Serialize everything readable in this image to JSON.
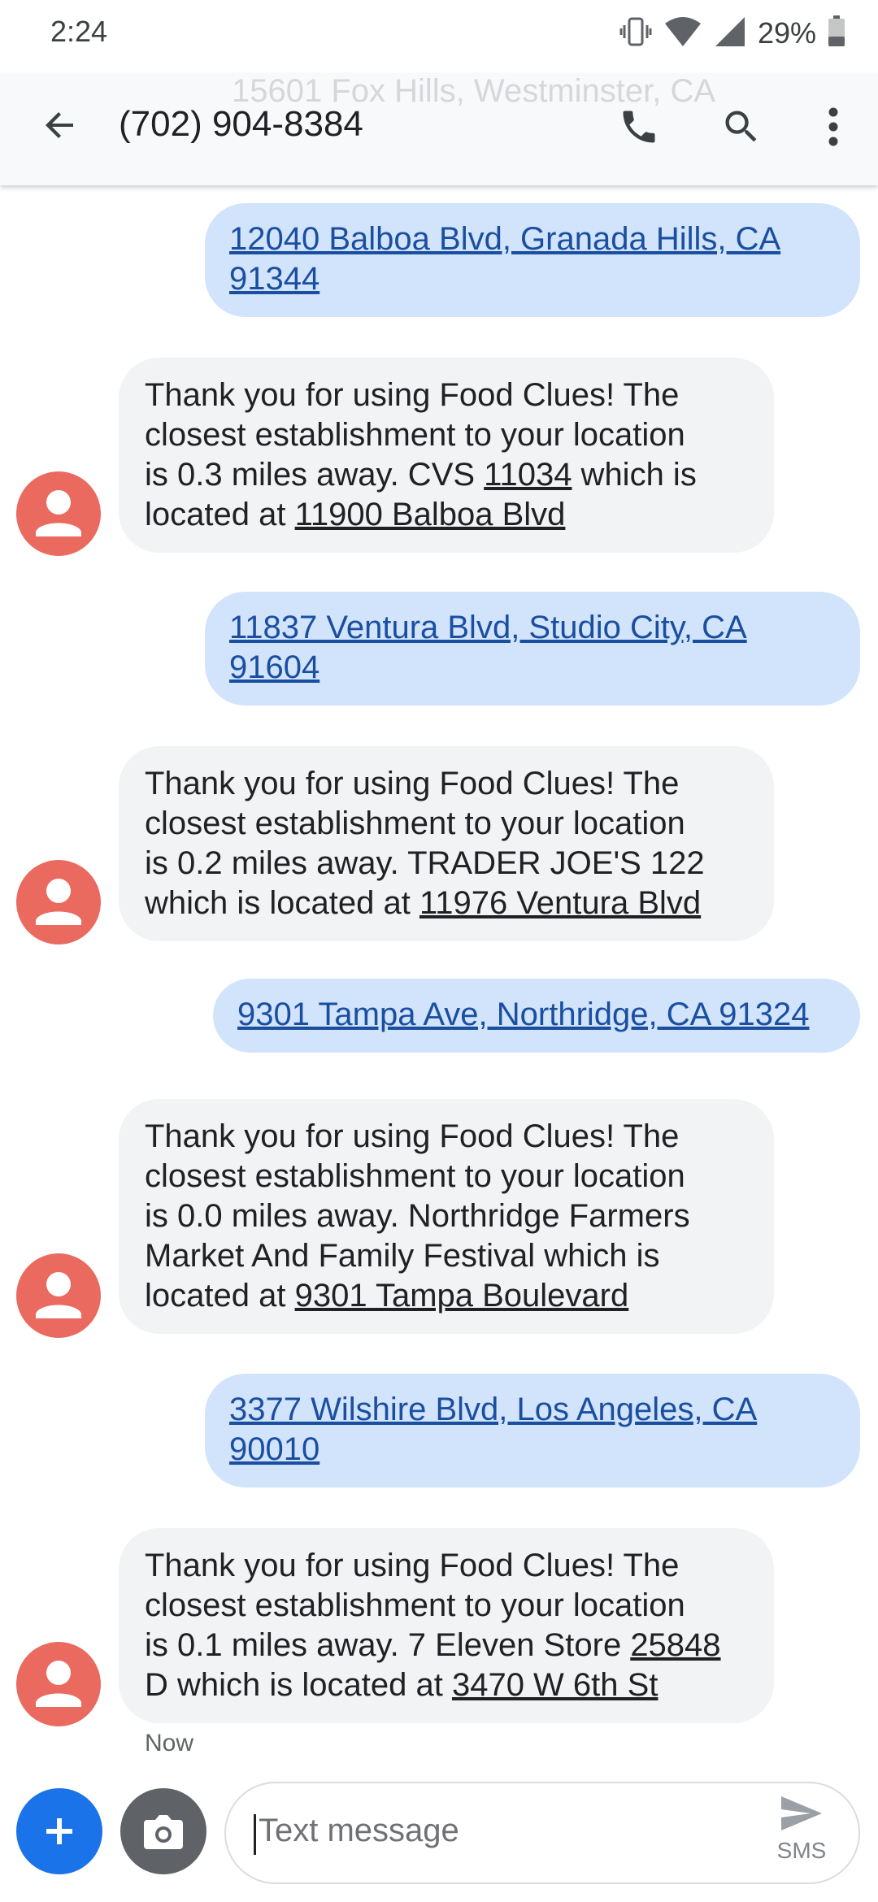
{
  "status_bar": {
    "time": "2:24",
    "battery_percent": "29%",
    "icons": [
      "vibrate-icon",
      "wifi-icon",
      "cell-signal-icon",
      "battery-icon"
    ]
  },
  "app_bar": {
    "ghost_text": "15601 Fox Hills, Westminster, CA",
    "title": "(702) 904-8384",
    "icons": [
      "back-arrow-icon",
      "phone-icon",
      "search-icon",
      "more-vert-icon"
    ]
  },
  "colors": {
    "outgoing_bubble": "#d2e3fc",
    "incoming_bubble": "#f1f3f4",
    "link": "#1a4fa0",
    "avatar": "#ea6a5f",
    "fab": "#1a73e8"
  },
  "messages": [
    {
      "direction": "out",
      "lines": [
        "12040 Balboa Blvd, Granada Hills, CA",
        "91344"
      ]
    },
    {
      "direction": "in",
      "parts": [
        "Thank you for using Food Clues! The",
        "closest establishment to your location",
        "is 0.3 miles away. CVS ",
        "11034",
        " which is",
        "located at ",
        "11900 Balboa Blvd"
      ]
    },
    {
      "direction": "out",
      "lines": [
        "11837 Ventura Blvd, Studio City, CA",
        "91604"
      ]
    },
    {
      "direction": "in",
      "parts": [
        "Thank you for using Food Clues! The",
        "closest establishment to your location",
        "is 0.2 miles away. TRADER JOE'S  122",
        "which is located at ",
        "11976 Ventura Blvd"
      ]
    },
    {
      "direction": "out",
      "lines": [
        "9301 Tampa Ave, Northridge, CA 91324"
      ]
    },
    {
      "direction": "in",
      "parts": [
        "Thank you for using Food Clues! The",
        "closest establishment to your location",
        "is 0.0 miles away. Northridge Farmers",
        "Market And Family Festival which is",
        "located at ",
        "9301 Tampa Boulevard"
      ]
    },
    {
      "direction": "out",
      "lines": [
        "3377 Wilshire Blvd, Los Angeles, CA",
        "90010"
      ]
    },
    {
      "direction": "in",
      "parts": [
        "Thank you for using Food Clues! The",
        "closest establishment to your location",
        "is 0.1 miles away. 7 Eleven Store ",
        "25848",
        "D which is located at ",
        "3470 W 6th St"
      ]
    }
  ],
  "last_timestamp": "Now",
  "compose": {
    "placeholder": "Text message",
    "send_label": "SMS"
  }
}
